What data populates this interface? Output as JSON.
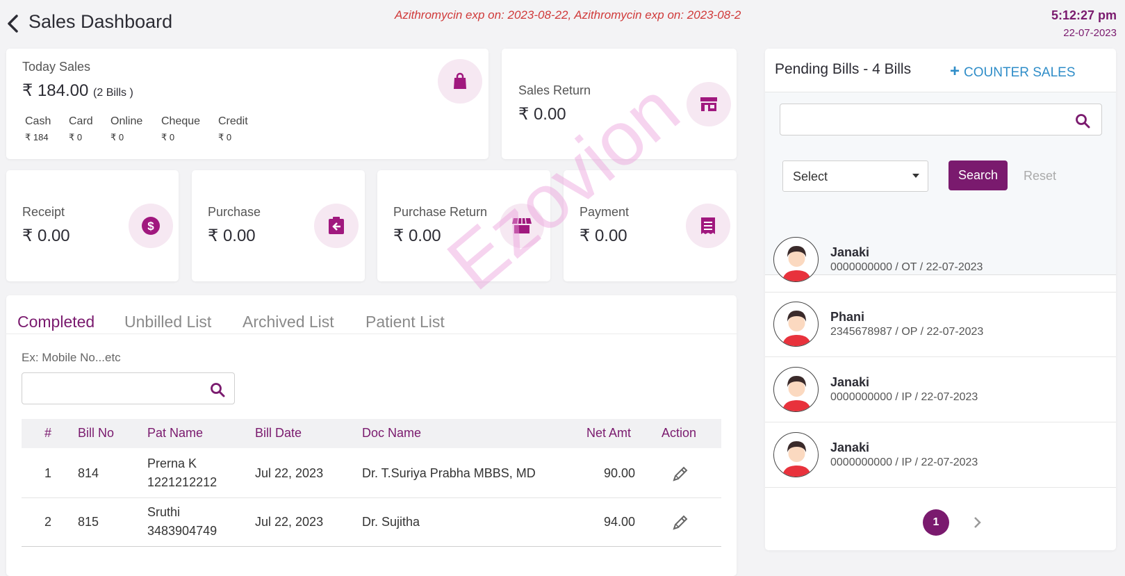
{
  "header": {
    "title": "Sales Dashboard",
    "alert": "Azithromycin exp on: 2023-08-22, Azithromycin exp on: 2023-08-2",
    "time": "5:12:27 pm",
    "date": "22-07-2023"
  },
  "today_sales": {
    "label": "Today Sales",
    "amount": "₹ 184.00",
    "bills": "(2 Bills )",
    "modes": [
      {
        "label": "Cash",
        "value": "₹ 184"
      },
      {
        "label": "Card",
        "value": "₹ 0"
      },
      {
        "label": "Online",
        "value": "₹ 0"
      },
      {
        "label": "Cheque",
        "value": "₹ 0"
      },
      {
        "label": "Credit",
        "value": "₹ 0"
      }
    ]
  },
  "sales_return": {
    "label": "Sales Return",
    "amount": "₹ 0.00"
  },
  "stats": [
    {
      "label": "Receipt",
      "amount": "₹ 0.00",
      "icon": "dollar-icon"
    },
    {
      "label": "Purchase",
      "amount": "₹ 0.00",
      "icon": "clipboard-arrow-icon"
    },
    {
      "label": "Purchase Return",
      "amount": "₹ 0.00",
      "icon": "store-icon"
    },
    {
      "label": "Payment",
      "amount": "₹ 0.00",
      "icon": "receipt-icon"
    }
  ],
  "tabs": [
    "Completed",
    "Unbilled List",
    "Archived List",
    "Patient List"
  ],
  "list_search": {
    "label": "Ex: Mobile No...etc"
  },
  "table": {
    "headers": [
      "#",
      "Bill No",
      "Pat Name",
      "Bill Date",
      "Doc Name",
      "Net Amt",
      "Action"
    ],
    "rows": [
      {
        "num": "1",
        "bill_no": "814",
        "pat_name": "Prerna K",
        "pat_phone": "1221212212",
        "bill_date": "Jul 22, 2023",
        "doc_name": "Dr. T.Suriya Prabha MBBS, MD",
        "net_amt": "90.00"
      },
      {
        "num": "2",
        "bill_no": "815",
        "pat_name": "Sruthi",
        "pat_phone": "3483904749",
        "bill_date": "Jul 22, 2023",
        "doc_name": "Dr. Sujitha",
        "net_amt": "94.00"
      }
    ]
  },
  "pending": {
    "title": "Pending Bills - 4 Bills",
    "counter_sales": "COUNTER SALES",
    "select": "Select",
    "search_btn": "Search",
    "reset": "Reset",
    "bills": [
      {
        "name": "Janaki",
        "details": "0000000000 / OT / 22-07-2023"
      },
      {
        "name": "Phani",
        "details": "2345678987 / OP / 22-07-2023"
      },
      {
        "name": "Janaki",
        "details": "0000000000 / IP / 22-07-2023"
      },
      {
        "name": "Janaki",
        "details": "0000000000 / IP / 22-07-2023"
      }
    ],
    "page": "1"
  },
  "watermark": "Ezovion",
  "colors": {
    "accent": "#7a1a6e",
    "alert": "#d03a3a",
    "link": "#2f8dc8"
  }
}
